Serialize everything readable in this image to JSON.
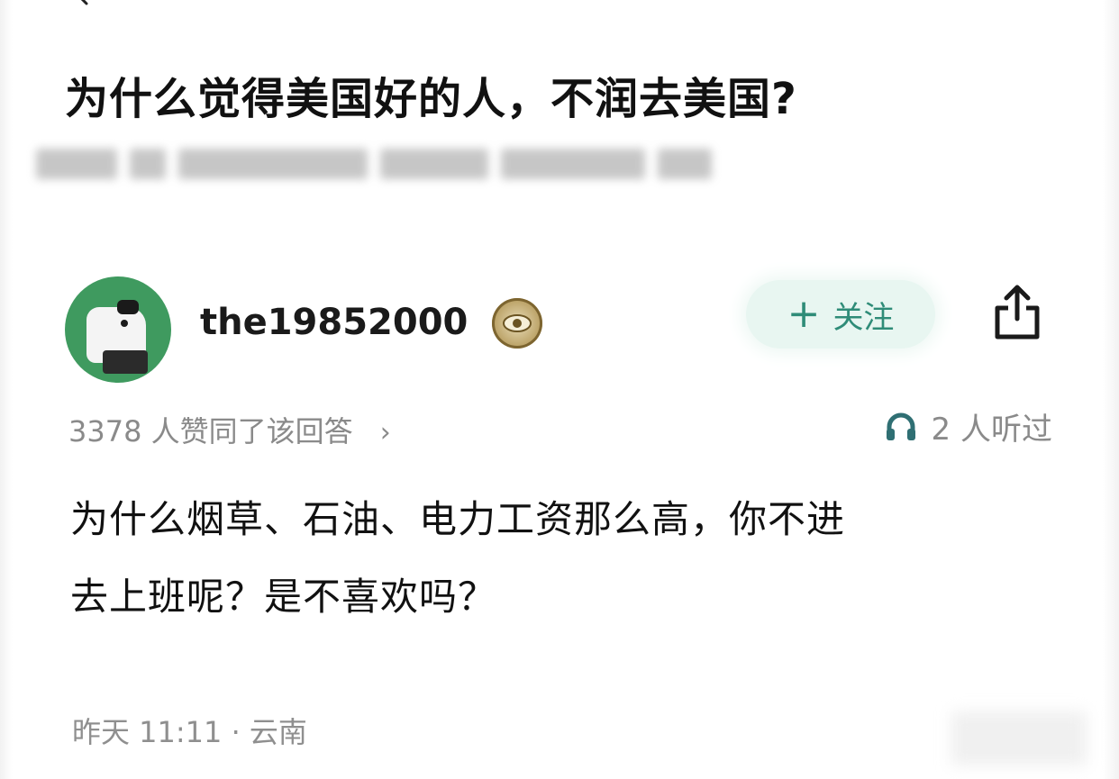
{
  "question": {
    "title": "为什么觉得美国好的人，不润去美国?"
  },
  "author": {
    "username": "the19852000",
    "follow_label": "关注",
    "follow_icon": "plus-icon",
    "share_icon": "share-icon",
    "badge_icon": "eye-badge-icon"
  },
  "meta": {
    "upvote_text": "3378 人赞同了该回答",
    "upvote_chevron": "›",
    "listen_text": "2 人听过",
    "listen_icon": "headphones-icon"
  },
  "answer": {
    "line1": "为什么烟草、石油、电力工资那么高，你不进",
    "line2": "去上班呢？是不喜欢吗？"
  },
  "footer": {
    "time_location": "昨天 11:11 · 云南"
  },
  "colors": {
    "accent": "#2f8c78",
    "follow_bg": "#e8f6f1",
    "avatar_bg": "#3f9a5f",
    "muted_text": "#8a8a8a"
  }
}
